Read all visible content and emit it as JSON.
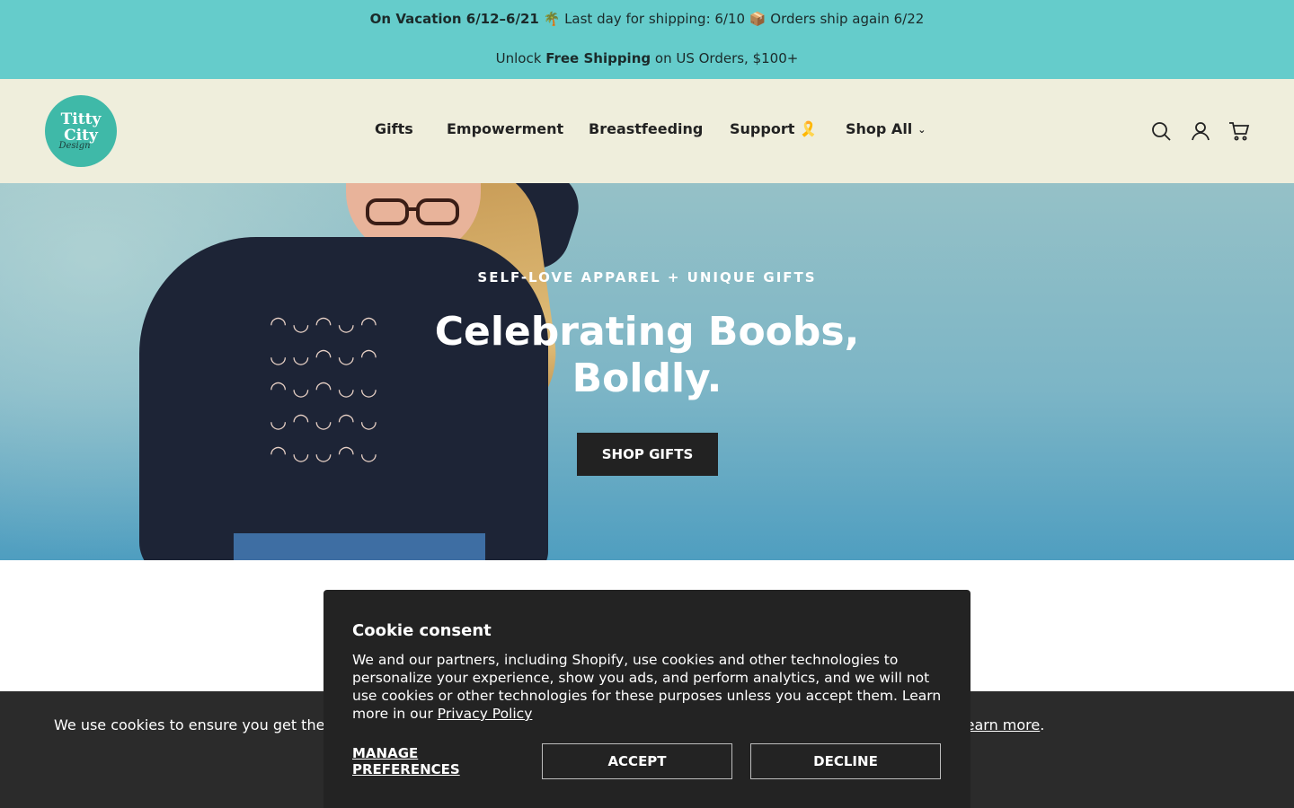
{
  "announcement": {
    "line1_bold": "On Vacation 6/12–6/21",
    "line1_rest": " 🌴 Last day for shipping: 6/10 📦 Orders ship again 6/22",
    "line2_pre": "Unlock ",
    "line2_bold": "Free Shipping",
    "line2_post": " on US Orders, $100+"
  },
  "logo": {
    "line1": "Titty",
    "line2": "City",
    "script": "Design"
  },
  "nav": {
    "items": [
      {
        "label": "Gifts"
      },
      {
        "label": "Empowerment"
      },
      {
        "label": "Breastfeeding"
      },
      {
        "label": "Support 🎗️"
      },
      {
        "label": "Shop All"
      }
    ]
  },
  "header_icons": [
    "search-icon",
    "account-icon",
    "cart-icon"
  ],
  "hero": {
    "eyebrow": "SELF-LOVE APPAREL + UNIQUE GIFTS",
    "title": "Celebrating Boobs, Boldly.",
    "button": "SHOP GIFTS"
  },
  "cookie_bar": {
    "text": "We use cookies to ensure you get the b",
    "learn_prefix": "",
    "learn_link": "Learn more",
    "learn_suffix": "."
  },
  "consent": {
    "title": "Cookie consent",
    "body": "We and our partners, including Shopify, use cookies and other technologies to personalize your experience, show you ads, and perform analytics, and we will not use cookies or other technologies for these purposes unless you accept them. Learn more in our ",
    "privacy_link": "Privacy Policy",
    "manage": "MANAGE PREFERENCES",
    "accept": "ACCEPT",
    "decline": "DECLINE"
  },
  "colors": {
    "announcement_bg": "#65cccb",
    "header_bg": "#efeedc",
    "logo_bg": "#3fb9a8",
    "dark": "#222222"
  }
}
